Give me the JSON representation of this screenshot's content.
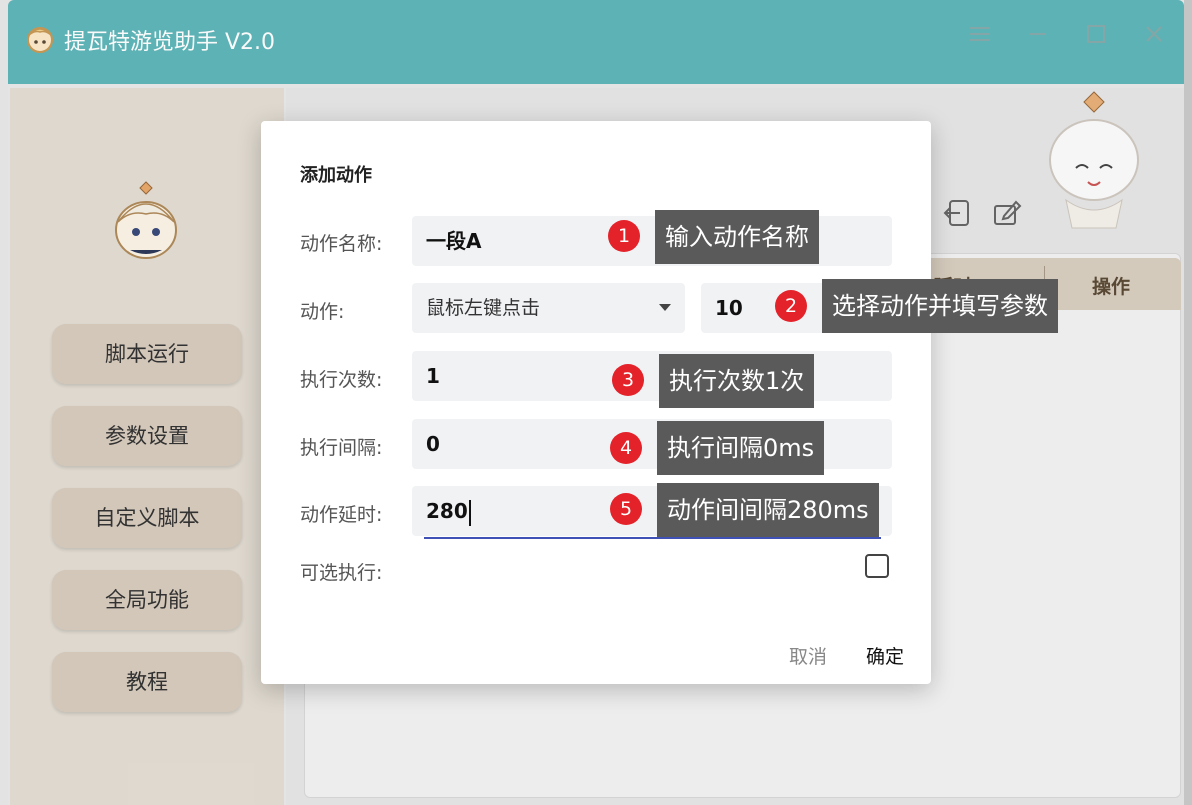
{
  "window": {
    "title": "提瓦特游览助手 V2.0",
    "controls": [
      "menu-icon",
      "minimize-icon",
      "maximize-icon",
      "close-icon"
    ]
  },
  "sidebar": {
    "items": [
      {
        "label": "脚本运行"
      },
      {
        "label": "参数设置"
      },
      {
        "label": "自定义脚本"
      },
      {
        "label": "全局功能"
      },
      {
        "label": "教程"
      }
    ]
  },
  "table": {
    "columns": [
      "延时",
      "操作"
    ]
  },
  "dialog": {
    "title": "添加动作",
    "name_label": "动作名称:",
    "name_value": "一段A",
    "action_label": "动作:",
    "action_selected": "鼠标左键点击",
    "action_param": "10",
    "count_label": "执行次数:",
    "count_value": "1",
    "interval_label": "执行间隔:",
    "interval_value": "0",
    "delay_label": "动作延时:",
    "delay_value": "280",
    "optional_label": "可选执行:",
    "optional_checked": false,
    "cancel": "取消",
    "ok": "确定"
  },
  "annotations": [
    {
      "num": "1",
      "text": "输入动作名称"
    },
    {
      "num": "2",
      "text": "选择动作并填写参数"
    },
    {
      "num": "3",
      "text": "执行次数1次"
    },
    {
      "num": "4",
      "text": "执行间隔0ms"
    },
    {
      "num": "5",
      "text": "动作间间隔280ms"
    }
  ],
  "colors": {
    "titlebar": "#5fb6b9",
    "nav_button": "#d7cbbd",
    "badge": "#e4222a",
    "tip": "#5a5a5a",
    "focus_underline": "#3f51b5"
  }
}
